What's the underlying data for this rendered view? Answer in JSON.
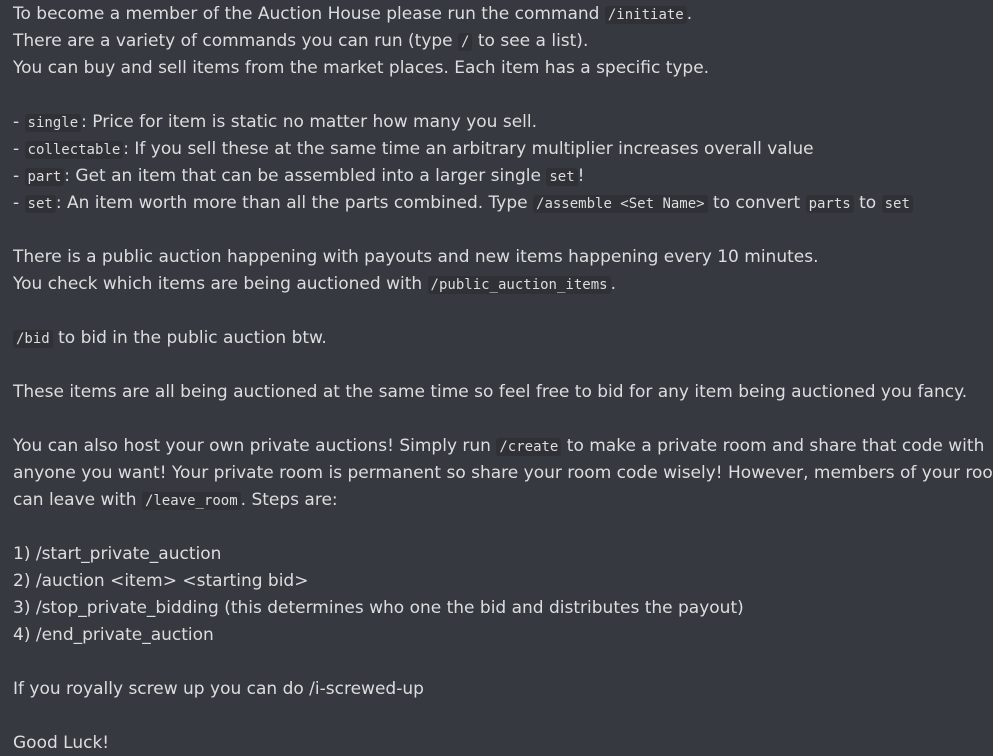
{
  "message": {
    "intro": {
      "l1_pre": "To become a member of the Auction House please run the command ",
      "l1_code": "/initiate",
      "l1_post": ".",
      "l2_pre": "There are a variety of commands you can run (type ",
      "l2_code": "/",
      "l2_post": " to see a list).",
      "l3": "You can buy and sell items from the market places. Each item has a specific type."
    },
    "types": [
      {
        "prefix": "- ",
        "code": "single",
        "text": ": Price for item is static no matter how many you sell."
      },
      {
        "prefix": "- ",
        "code": "collectable",
        "text": ": If you sell these at the same time an arbitrary multiplier increases overall value"
      },
      {
        "prefix": "- ",
        "code": "part",
        "text": ": Get an item that can be assembled into a larger single ",
        "code2": "set",
        "post": "!"
      },
      {
        "prefix": "- ",
        "code": "set",
        "text": ": An item worth more than all the parts combined. Type ",
        "code2": "/assemble <Set Name>",
        "mid": " to convert ",
        "code3": "parts",
        "mid2": " to ",
        "code4": "set"
      }
    ],
    "public": {
      "l1": "There is a public auction happening with payouts and new items happening every 10 minutes.",
      "l2_pre": "You check which items are being auctioned with ",
      "l2_code": "/public_auction_items",
      "l2_post": "."
    },
    "bid": {
      "code": "/bid",
      "text": " to bid in the public auction btw."
    },
    "same_time": "These items are all being auctioned at the same time so feel free to bid for any item being auctioned you fancy.",
    "private": {
      "l1_pre": "You can also host your own private auctions! Simply run ",
      "l1_code": "/create",
      "l1_post": " to make a private room and share that code with",
      "l2": "anyone you want! Your private room is permanent so share your room code wisely! However, members of your room",
      "l3_pre": "can leave with ",
      "l3_code": "/leave_room",
      "l3_post": ". Steps are:"
    },
    "steps": [
      "1) /start_private_auction",
      "2) /auction <item> <starting bid>",
      "3) /stop_private_bidding (this determines who one the bid and distributes the payout)",
      "4) /end_private_auction"
    ],
    "screwed": "If you royally screw up you can do /i-screwed-up",
    "luck": "Good Luck!"
  }
}
